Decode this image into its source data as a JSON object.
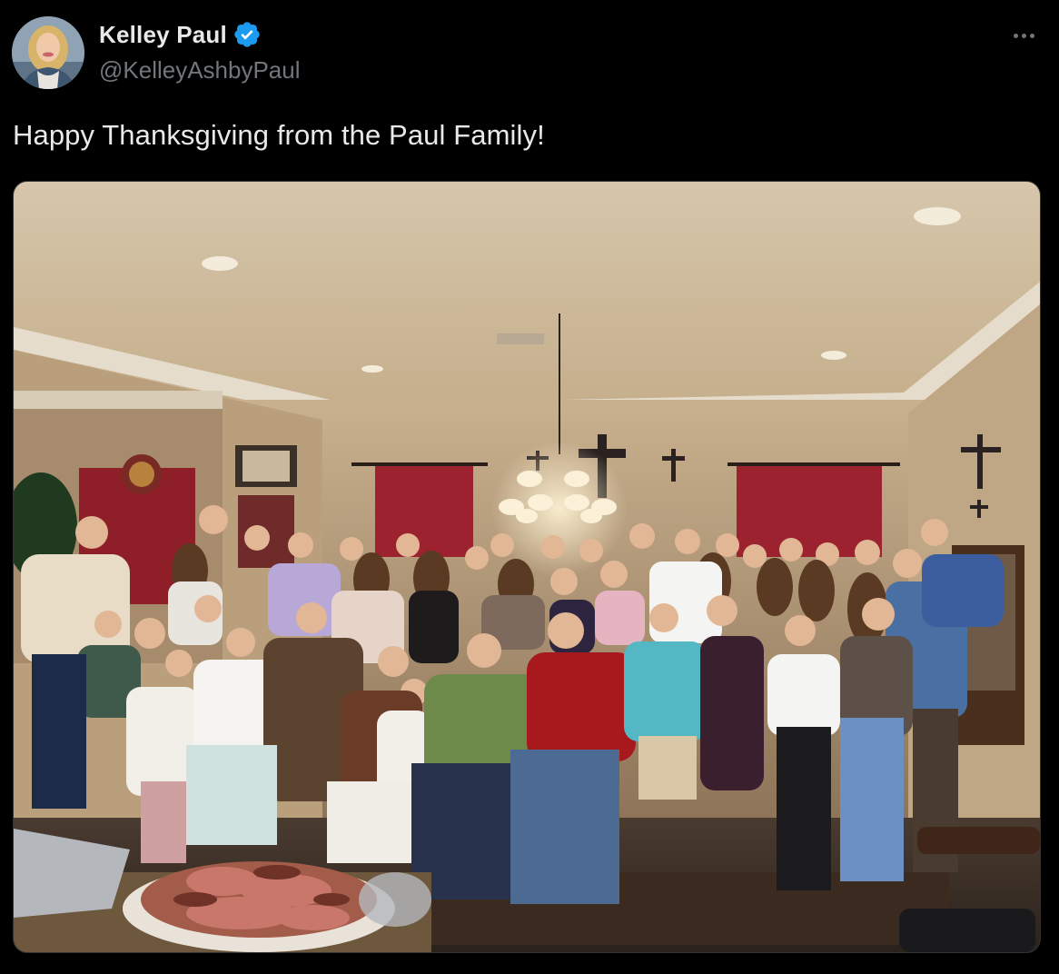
{
  "author": {
    "display_name": "Kelley Paul",
    "handle": "@KelleyAshbyPaul",
    "verified": true,
    "verified_color": "#1d9bf0"
  },
  "tweet": {
    "text": "Happy Thanksgiving from the Paul Family!"
  },
  "media": {
    "kind": "photo"
  },
  "icons": {
    "verified": "verified-badge-icon",
    "more": "more-horizontal-icon"
  }
}
